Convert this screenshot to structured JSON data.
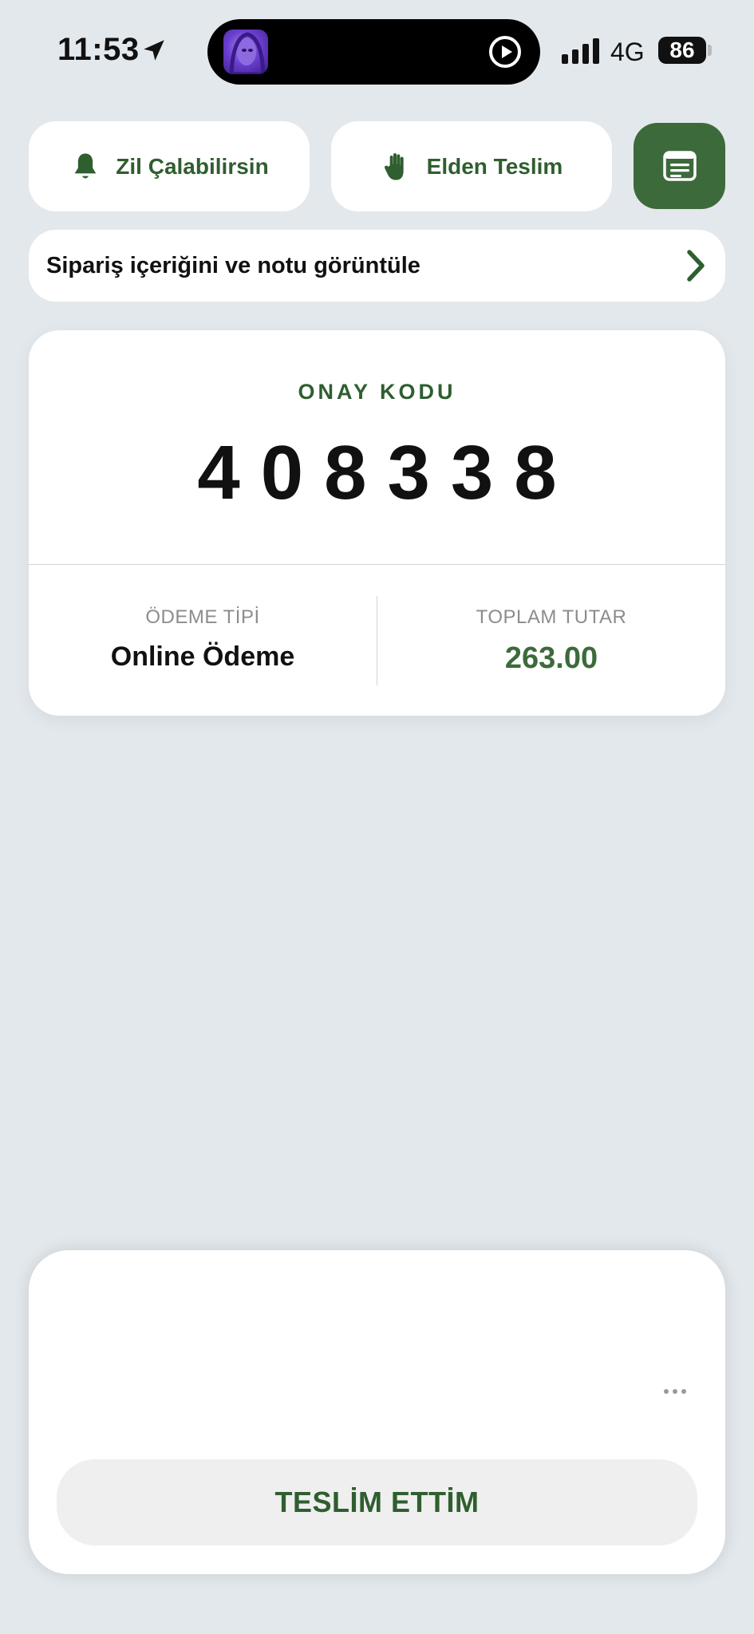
{
  "status_bar": {
    "time": "11:53",
    "network": "4G",
    "battery": "86",
    "icons": [
      "location-arrow-icon",
      "signal-bars-icon",
      "battery-icon",
      "play-circle-icon"
    ]
  },
  "actions": {
    "bell_label": "Zil Çalabilirsin",
    "hand_label": "Elden Teslim",
    "note_button_icon": "note-icon"
  },
  "order": {
    "view_label": "Sipariş içeriğini ve notu görüntüle"
  },
  "code_card": {
    "label": "ONAY KODU",
    "code": "408338",
    "payment_type_label": "ÖDEME TİPİ",
    "payment_type_value": "Online Ödeme",
    "total_label": "TOPLAM TUTAR",
    "total_value": "263.00"
  },
  "sheet": {
    "deliver_label": "TESLİM ETTİM",
    "more_icon": "ellipsis-icon"
  },
  "colors": {
    "background": "#e3e8ec",
    "accent_green": "#3d6a3a",
    "text_green": "#2f5e2f"
  }
}
